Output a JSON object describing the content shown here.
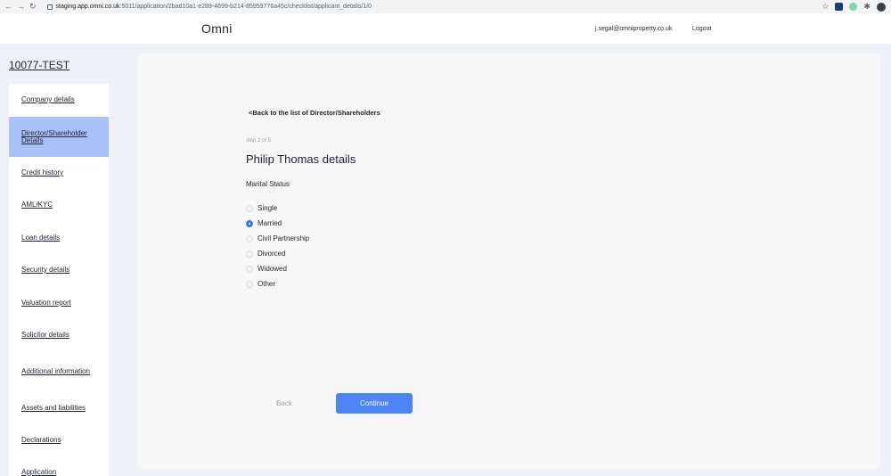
{
  "browser": {
    "host": "staging.app.omni.co.uk",
    "path": ":5011/application/2bad10a1-e289-4699-b214-85959776a45c/checklist/applicant_details/1/0"
  },
  "header": {
    "logo": "Omni",
    "user_email": "j.segal@omniproperty.co.uk",
    "logout_label": "Logout"
  },
  "case_id": "10077-TEST",
  "sidebar": {
    "items": [
      {
        "label": "Company details"
      },
      {
        "label": "Director/Shareholder Details"
      },
      {
        "label": "Credit history"
      },
      {
        "label": "AML/KYC"
      },
      {
        "label": "Loan details"
      },
      {
        "label": "Security details"
      },
      {
        "label": "Valuation report"
      },
      {
        "label": "Solicitor details"
      },
      {
        "label": "Additional information"
      },
      {
        "label": "Assets and liabilities"
      },
      {
        "label": "Declarations"
      },
      {
        "label": "Application"
      }
    ],
    "active_index": 1
  },
  "form": {
    "back_link": "<Back to the list of Director/Shareholders",
    "step": "step 2 of 5",
    "title": "Philip Thomas details",
    "field_label": "Marital Status",
    "options": [
      {
        "label": "Single",
        "checked": false
      },
      {
        "label": "Married",
        "checked": true
      },
      {
        "label": "Civil Partnership",
        "checked": false
      },
      {
        "label": "Divorced",
        "checked": false
      },
      {
        "label": "Widowed",
        "checked": false
      },
      {
        "label": "Other",
        "checked": false
      }
    ],
    "back_button": "Back",
    "continue_button": "Continue"
  },
  "colors": {
    "accent": "#4e84f5",
    "active_nav": "#a9c1f8",
    "page_bg": "#eef2f8",
    "card_bg": "#f7f7f7"
  }
}
